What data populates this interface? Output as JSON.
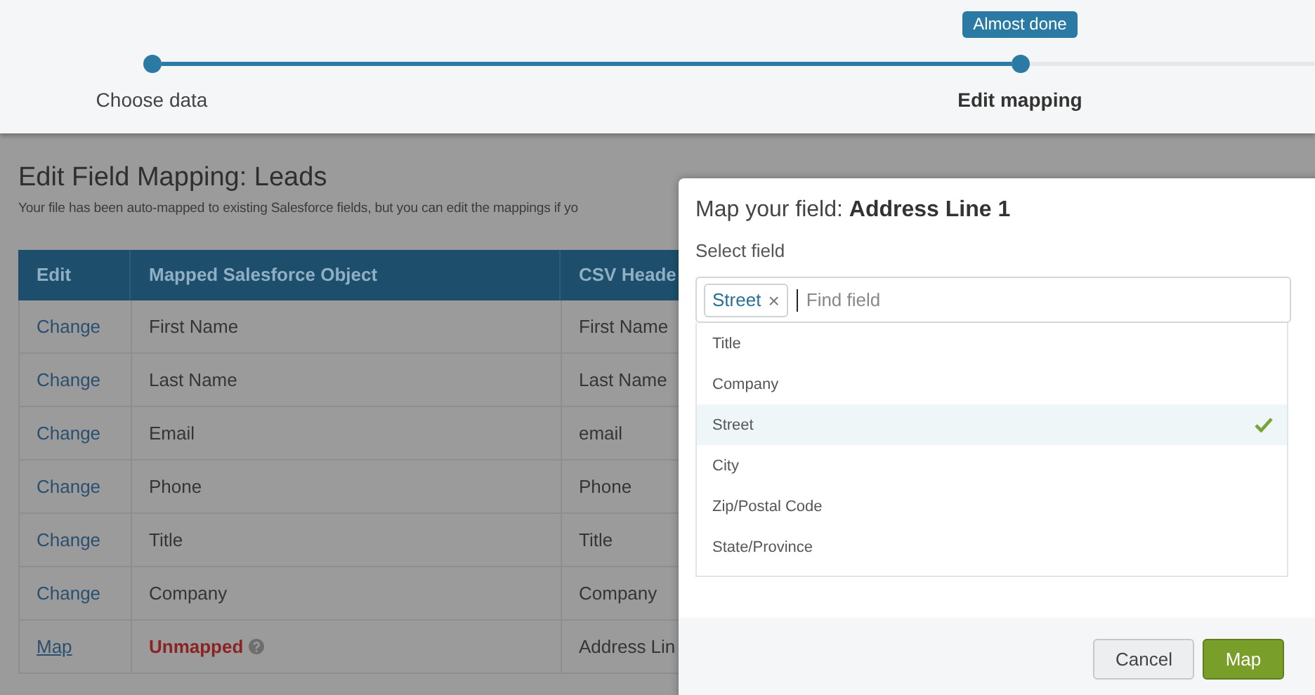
{
  "progress": {
    "tooltip": "Almost done",
    "steps": [
      {
        "label": "Choose data",
        "current": false
      },
      {
        "label": "Edit mapping",
        "current": true
      }
    ]
  },
  "page": {
    "title": "Edit Field Mapping: Leads",
    "subtitle": "Your file has been auto-mapped to existing Salesforce fields, but you can edit the mappings if yo"
  },
  "table": {
    "columns": [
      "Edit",
      "Mapped Salesforce Object",
      "CSV Heade"
    ],
    "rows": [
      {
        "action": "Change",
        "object": "First Name",
        "mapped": true,
        "csv": "First Name"
      },
      {
        "action": "Change",
        "object": "Last Name",
        "mapped": true,
        "csv": "Last Name"
      },
      {
        "action": "Change",
        "object": "Email",
        "mapped": true,
        "csv": "email"
      },
      {
        "action": "Change",
        "object": "Phone",
        "mapped": true,
        "csv": "Phone"
      },
      {
        "action": "Change",
        "object": "Title",
        "mapped": true,
        "csv": "Title"
      },
      {
        "action": "Change",
        "object": "Company",
        "mapped": true,
        "csv": "Company"
      },
      {
        "action": "Map",
        "object": "Unmapped",
        "mapped": false,
        "csv": "Address Lin"
      }
    ]
  },
  "modal": {
    "title": "Map your field: **Address Line 1**",
    "label": "Select field",
    "chip": "Street",
    "chip_remove": "×",
    "placeholder": "Find field",
    "options": [
      {
        "label": "Title",
        "selected": false
      },
      {
        "label": "Company",
        "selected": false
      },
      {
        "label": "Street",
        "selected": true
      },
      {
        "label": "City",
        "selected": false
      },
      {
        "label": "Zip/Postal Code",
        "selected": false
      },
      {
        "label": "State/Province",
        "selected": false
      }
    ],
    "buttons": [
      {
        "label": "Cancel",
        "kind": "secondary"
      },
      {
        "label": "Map",
        "kind": "primary"
      }
    ]
  }
}
